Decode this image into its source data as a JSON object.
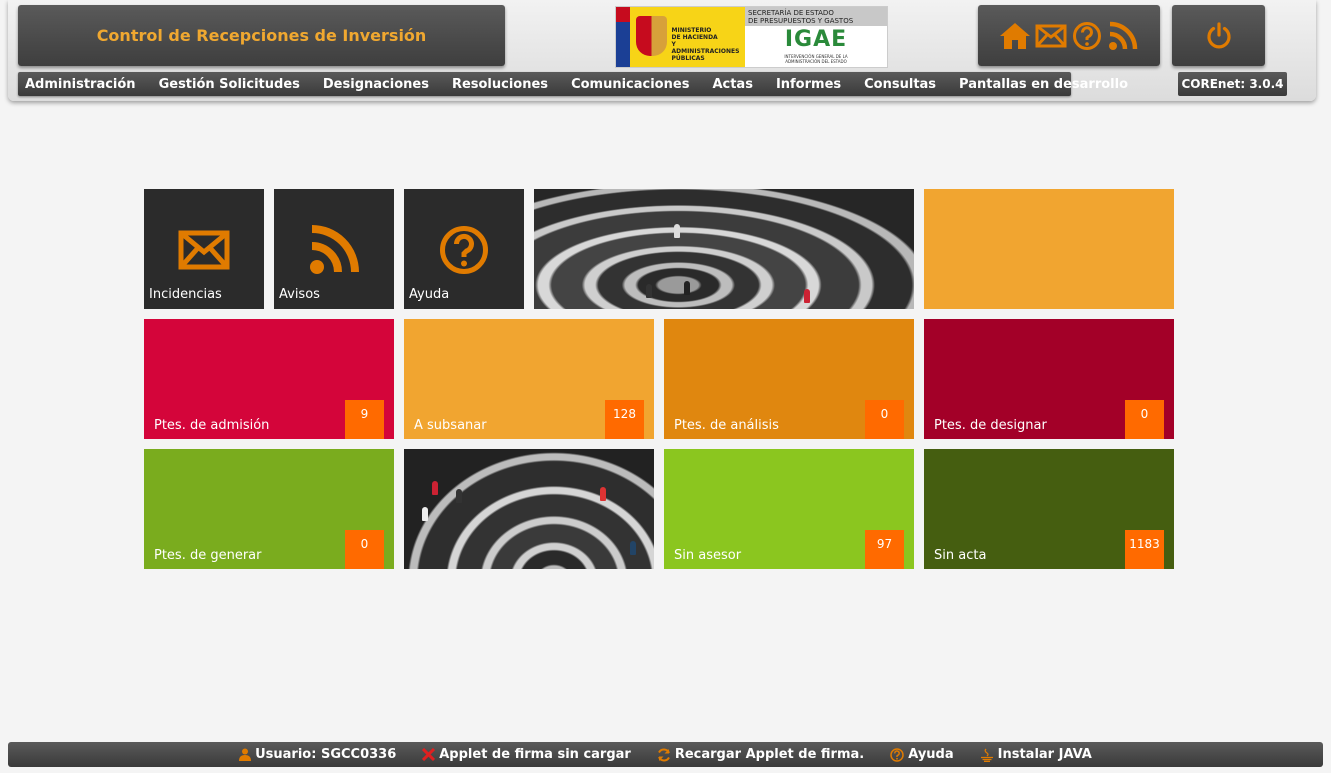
{
  "header": {
    "app_title": "Control de Recepciones de Inversión",
    "logo": {
      "ministry": [
        "MINISTERIO",
        "DE HACIENDA",
        "Y ADMINISTRACIONES",
        "PÚBLICAS"
      ],
      "secretaria": [
        "SECRETARÍA DE ESTADO",
        "DE PRESUPUESTOS Y GASTOS"
      ],
      "brand": "IGAE",
      "brand_sub": [
        "INTERVENCIÓN GENERAL DE LA",
        "ADMINISTRACIÓN DEL ESTADO"
      ]
    },
    "icons": [
      "home-icon",
      "mail-icon",
      "help-icon",
      "rss-icon",
      "power-icon"
    ],
    "accent": "#e07b00"
  },
  "menu": {
    "items": [
      "Administración",
      "Gestión Solicitudes",
      "Designaciones",
      "Resoluciones",
      "Comunicaciones",
      "Actas",
      "Informes",
      "Consultas",
      "Pantallas en desarrollo"
    ],
    "version": "COREnet: 3.0.4"
  },
  "tiles": {
    "incidencias": {
      "label": "Incidencias",
      "icon": "mail-icon"
    },
    "avisos": {
      "label": "Avisos",
      "icon": "rss-icon"
    },
    "ayuda": {
      "label": "Ayuda",
      "icon": "help-icon"
    },
    "admision": {
      "label": "Ptes. de admisión",
      "count": "9",
      "color": "#d4053a"
    },
    "subsanar": {
      "label": "A subsanar",
      "count": "128",
      "color": "#f1a530"
    },
    "analisis": {
      "label": "Ptes. de análisis",
      "count": "0",
      "color": "#e0870f"
    },
    "designar": {
      "label": "Ptes. de designar",
      "count": "0",
      "color": "#a30028"
    },
    "generar": {
      "label": "Ptes. de generar",
      "count": "0",
      "color": "#7aac1e"
    },
    "asesor": {
      "label": "Sin asesor",
      "count": "97",
      "color": "#8bc61f"
    },
    "acta": {
      "label": "Sin acta",
      "count": "1183",
      "color": "#455e10"
    },
    "count_color": "#ff6a00"
  },
  "footer": {
    "user": "Usuario: SGCC0336",
    "applet_status": "Applet de firma sin cargar",
    "reload": "Recargar Applet de firma.",
    "help": "Ayuda",
    "install_java": "Instalar JAVA"
  }
}
